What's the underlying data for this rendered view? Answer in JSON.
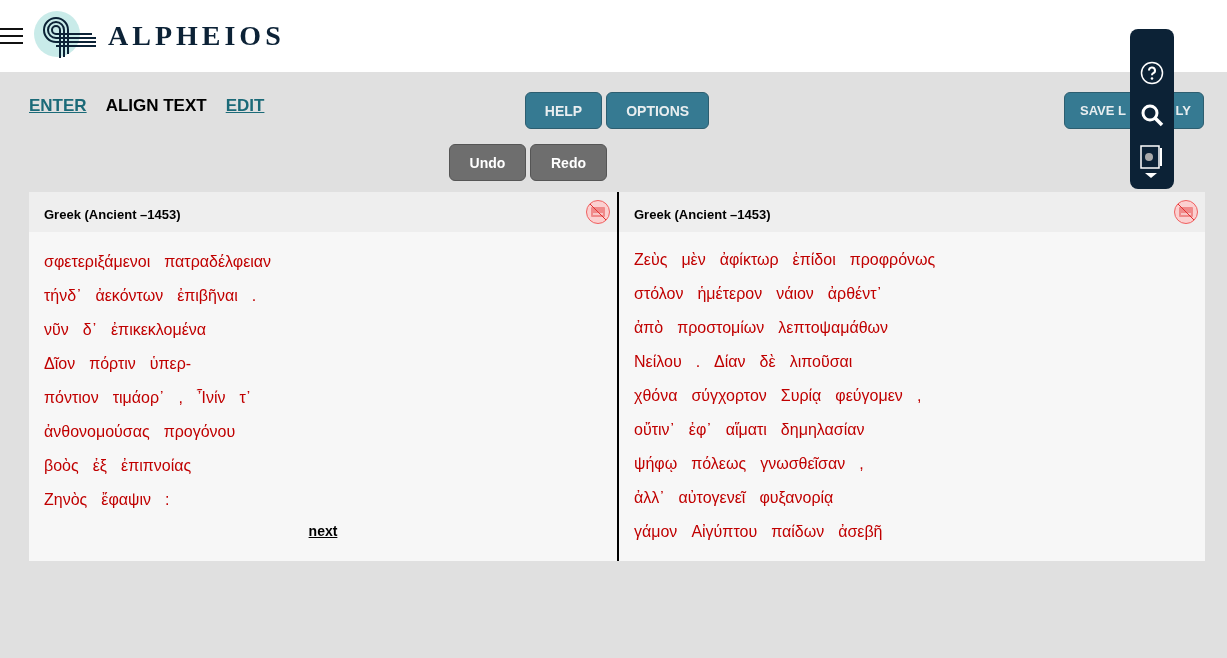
{
  "header": {
    "brand": "ALPHEIOS"
  },
  "steps": [
    {
      "label": "ENTER",
      "selected": false
    },
    {
      "label": "ALIGN TEXT",
      "selected": true
    },
    {
      "label": "EDIT",
      "selected": false
    }
  ],
  "actions": [
    "HELP",
    "OPTIONS"
  ],
  "save_button": [
    "SAVE L",
    "LY"
  ],
  "history": [
    "Undo",
    "Redo"
  ],
  "panels": [
    {
      "language": "Greek (Ancient –1453)",
      "lines": [
        [
          "σφετεριξάμενοι",
          "πατραδέλφειαν"
        ],
        [
          "τήνδ᾽",
          "ἀεκόντων",
          "ἐπιβῆναι",
          "."
        ],
        [
          "νῦν",
          "δ᾽",
          "ἐπικεκλομένα"
        ],
        [
          "Δῖον",
          "πόρτιν",
          "ὑπερ-"
        ],
        [
          "πόντιον",
          "τιμάορ᾽",
          ",",
          "Ἶνίν",
          "τ᾽"
        ],
        [
          "ἀνθονομούσας",
          "προγόνου"
        ],
        [
          "βοὸς",
          "ἐξ",
          "ἐπιπνοίας"
        ],
        [
          "Ζηνὸς",
          "ἔφαψιν",
          ":"
        ]
      ],
      "link": "next"
    },
    {
      "language": "Greek (Ancient –1453)",
      "lines": [
        [
          "Ζεὺς",
          "μὲν",
          "ἀφίκτωρ",
          "ἐπίδοι",
          "προφρόνως"
        ],
        [
          "στόλον",
          "ἡμέτερον",
          "νάιον",
          "ἀρθέντ᾽"
        ],
        [
          "ἀπὸ",
          "προστομίων",
          "λεπτοψαμάθων"
        ],
        [
          "Νείλου",
          ".",
          "Δίαν",
          "δὲ",
          "λιποῦσαι"
        ],
        [
          "χθόνα",
          "σύγχορτον",
          "Συρίᾳ",
          "φεύγομεν",
          ","
        ],
        [
          "οὔτιν᾽",
          "ἐφ᾽",
          "αἵματι",
          "δημηλασίαν"
        ],
        [
          "ψήφῳ",
          "πόλεως",
          "γνωσθεῖσαν",
          ","
        ],
        [
          "ἀλλ᾽",
          "αὐτογενεῖ",
          "φυξανορίᾳ"
        ],
        [
          "γάμον",
          "Αἰγύπτου",
          "παίδων",
          "ἀσεβῆ"
        ]
      ]
    }
  ]
}
